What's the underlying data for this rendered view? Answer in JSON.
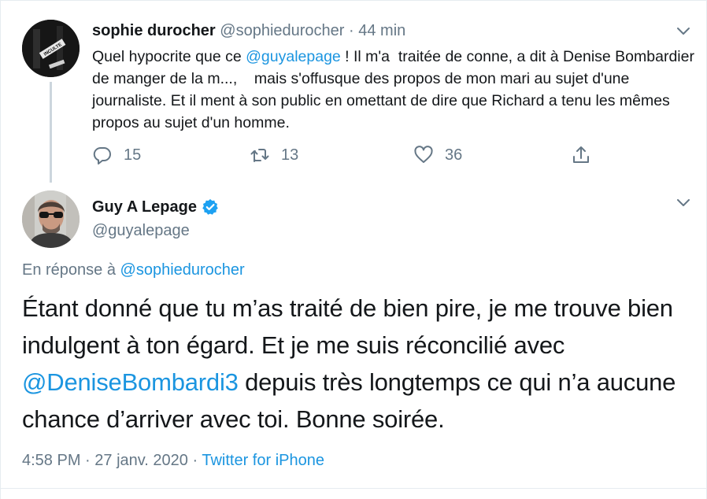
{
  "parent_tweet": {
    "name": "sophie durocher",
    "handle": "@sophiedurocher",
    "separator": "·",
    "time": "44 min",
    "text_before": "Quel hypocrite que ce ",
    "mention": "@guyalepage",
    "text_after": " ! Il m'a  traitée de conne, a dit à Denise Bombardier de manger de la m...,    mais s'offusque des propos de mon mari au sujet d'une journaliste. Et il ment à son public en omettant de dire que Richard a tenu les mêmes propos au sujet d'un homme.",
    "replies": "15",
    "retweets": "13",
    "likes": "36",
    "avatar_sign_text": "INCULTE"
  },
  "main_tweet": {
    "name": "Guy A Lepage",
    "handle": "@guyalepage",
    "reply_prefix": "En réponse à ",
    "reply_handle": "@sophiedurocher",
    "text_before": "Étant donné que tu m’as traité de bien pire, je me trouve bien indulgent à ton égard. Et je me suis réconcilié avec ",
    "mention": "@DeniseBombardi3",
    "text_after": " depuis très longtemps ce qui n’a aucune chance d’arriver avec toi. Bonne soirée.",
    "time": "4:58 PM",
    "separator1": "·",
    "date": "27 janv. 2020",
    "separator2": "·",
    "source": "Twitter for iPhone"
  },
  "colors": {
    "text": "#14171a",
    "muted": "#657786",
    "link": "#1b95e0",
    "border": "#e6ecf0",
    "thread_line": "#ccd6dd",
    "verified": "#1da1f2"
  },
  "icons": [
    "reply-icon",
    "retweet-icon",
    "like-icon",
    "share-icon",
    "chevron-down-icon",
    "verified-badge-icon"
  ]
}
